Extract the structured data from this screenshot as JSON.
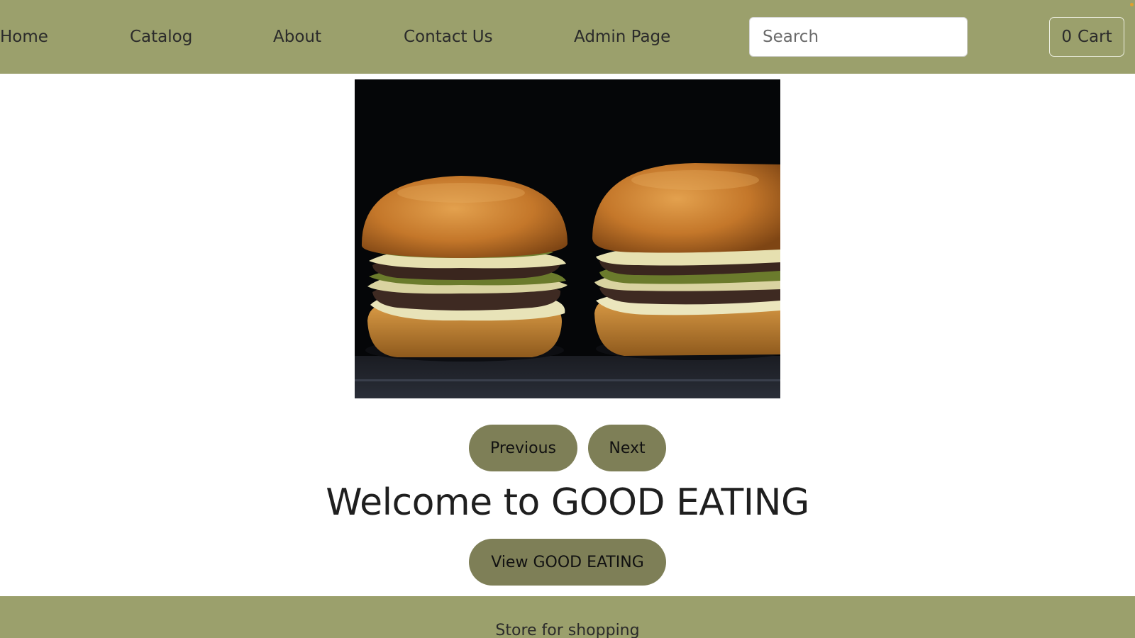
{
  "nav": {
    "links": [
      "Home",
      "Catalog",
      "About",
      "Contact Us",
      "Admin Page"
    ],
    "search_placeholder": "Search",
    "cart_count": "0",
    "cart_label": "Cart"
  },
  "hero": {
    "image_subject": "two-cheeseburgers-photo"
  },
  "carousel": {
    "prev_label": "Previous",
    "next_label": "Next"
  },
  "main": {
    "welcome": "Welcome to GOOD EATING",
    "view_label": "View GOOD EATING"
  },
  "footer": {
    "text": "Store for shopping"
  },
  "colors": {
    "nav_bg": "#9ba06c",
    "button_bg": "#7e7f57",
    "footer_bg": "#9ba06c"
  }
}
